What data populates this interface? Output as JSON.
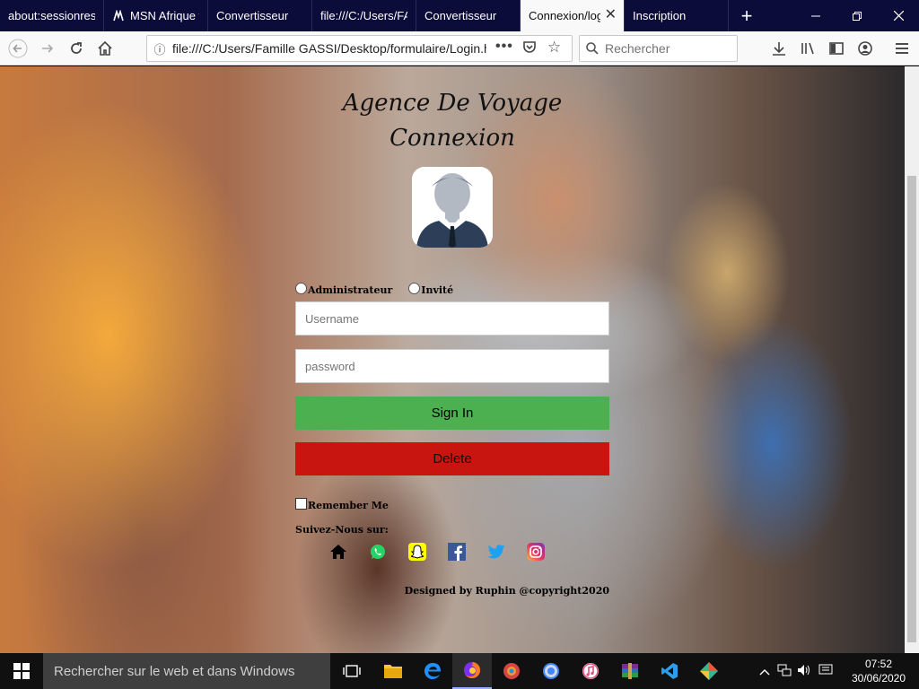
{
  "browser": {
    "tabs": [
      {
        "label": "about:sessionrestore",
        "active": false
      },
      {
        "label": "MSN Afrique francophone",
        "active": false
      },
      {
        "label": "Convertisseur",
        "active": false
      },
      {
        "label": "file:///C:/Users/FA",
        "active": false
      },
      {
        "label": "Convertisseur",
        "active": false
      },
      {
        "label": "Connexion/login",
        "active": true
      },
      {
        "label": "Inscription",
        "active": false
      }
    ],
    "new_tab": "+",
    "url": "file:///C:/Users/Famille GASSI/Desktop/formulaire/Login.html",
    "search_placeholder": "Rechercher"
  },
  "page": {
    "title_line1": "Agence De Voyage",
    "title_line2": "Connexion",
    "roles": [
      "Administrateur",
      "Invité"
    ],
    "username_placeholder": "Username",
    "password_placeholder": "password",
    "signin_label": "Sign In",
    "delete_label": "Delete",
    "remember_label": "Remember Me",
    "follow_label": "Suivez-Nous sur:",
    "socials": [
      "home-icon",
      "whatsapp-icon",
      "snapchat-icon",
      "facebook-icon",
      "twitter-icon",
      "instagram-icon"
    ],
    "footer": "Designed by Ruphin @copyright2020"
  },
  "taskbar": {
    "search_placeholder": "Rechercher sur le web et dans Windows",
    "time": "07:52",
    "date": "30/06/2020"
  },
  "colors": {
    "signin": "#4caf50",
    "delete": "#c8150f",
    "tabbar": "#0c0c3a"
  }
}
